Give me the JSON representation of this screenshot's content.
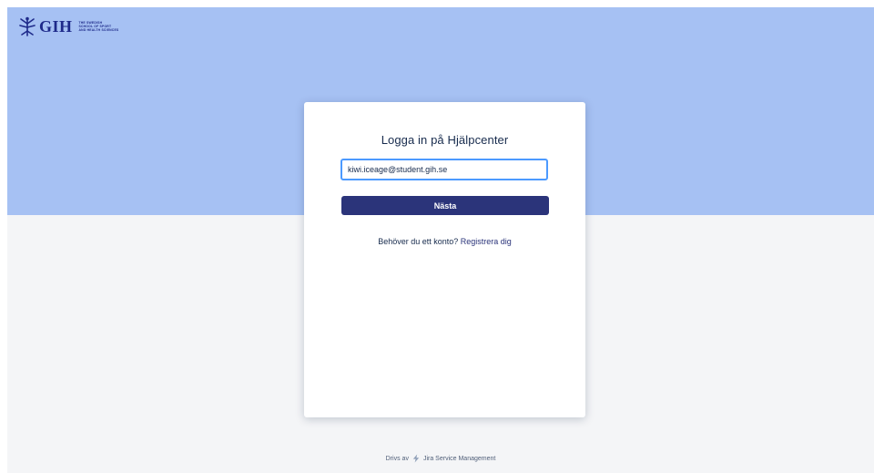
{
  "header": {
    "logo_text": "GIH",
    "logo_subtitle": [
      "The Swedish",
      "School of Sport",
      "and Health Sciences"
    ]
  },
  "login": {
    "title": "Logga in på Hjälpcenter",
    "email_value": "kiwi.iceage@student.gih.se",
    "next_label": "Nästa",
    "signup_prompt": "Behöver du ett konto?",
    "signup_link": "Registrera dig"
  },
  "footer": {
    "prefix": "Drivs av",
    "product": "Jira Service Management"
  },
  "colors": {
    "hero": "#a6c1f3",
    "page_background": "#f4f5f7",
    "primary_button": "#2b347a",
    "input_focus_border": "#4c9aff"
  }
}
